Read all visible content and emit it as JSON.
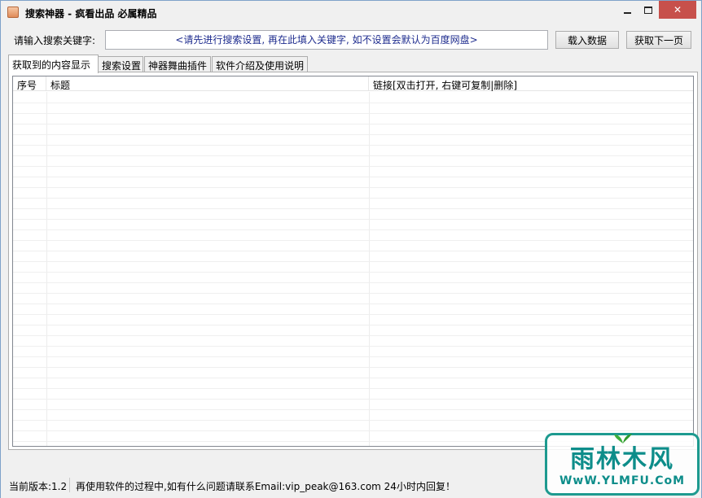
{
  "window": {
    "title": "搜索神器 - 疯看出品 必属精品",
    "minimize_icon": "minimize-icon",
    "maximize_icon": "maximize-icon",
    "close_icon": "close-icon",
    "close_glyph": "✕"
  },
  "keyword": {
    "label": "请输入搜索关键字:",
    "value": "",
    "placeholder": "<请先进行搜索设置, 再在此填入关键字, 如不设置会默认为百度网盘>"
  },
  "buttons": {
    "load": "载入数据",
    "next": "获取下一页"
  },
  "tabs": [
    {
      "label": "获取到的内容显示",
      "active": true
    },
    {
      "label": "搜索设置",
      "active": false
    },
    {
      "label": "神器舞曲插件",
      "active": false
    },
    {
      "label": "软件介绍及使用说明",
      "active": false
    }
  ],
  "list": {
    "columns": [
      {
        "label": "序号"
      },
      {
        "label": "标题"
      },
      {
        "label": "链接[双击打开, 右键可复制|删除]"
      }
    ],
    "rows": []
  },
  "status": {
    "version": "当前版本:1.2",
    "message": "再使用软件的过程中,如有什么问题请联系Email:vip_peak@163.com 24小时内回复！"
  },
  "watermark": {
    "main": "雨林木风",
    "sub": "WwW.YLMFU.CoM"
  },
  "colors": {
    "close_button": "#c7504b",
    "watermark": "#0d8d8a",
    "placeholder_text": "#1f2d8f"
  }
}
